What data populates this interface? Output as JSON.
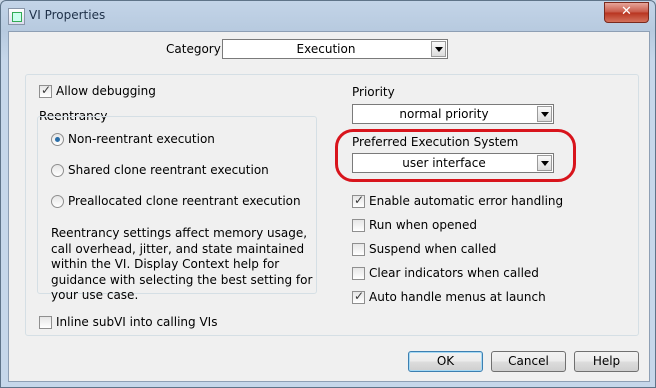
{
  "window": {
    "title": "VI Properties",
    "close_glyph": "✕"
  },
  "category": {
    "label": "Category",
    "value": "Execution"
  },
  "allow_debugging": {
    "label": "Allow debugging",
    "checked": true
  },
  "reentrancy": {
    "title": "Reentrancy",
    "options": [
      {
        "label": "Non-reentrant execution",
        "selected": true
      },
      {
        "label": "Shared clone reentrant execution",
        "selected": false
      },
      {
        "label": "Preallocated clone reentrant execution",
        "selected": false
      }
    ],
    "description": "Reentrancy settings affect memory usage, call overhead, jitter, and state maintained within the VI. Display Context help for guidance with selecting the best setting for your use case."
  },
  "inline_subvi": {
    "label": "Inline subVI into calling VIs",
    "checked": false
  },
  "priority": {
    "label": "Priority",
    "value": "normal priority"
  },
  "execution_system": {
    "label": "Preferred Execution System",
    "value": "user interface"
  },
  "options": [
    {
      "label": "Enable automatic error handling",
      "checked": true
    },
    {
      "label": "Run when opened",
      "checked": false
    },
    {
      "label": "Suspend when called",
      "checked": false
    },
    {
      "label": "Clear indicators when called",
      "checked": false
    },
    {
      "label": "Auto handle menus at launch",
      "checked": true
    }
  ],
  "buttons": {
    "ok": "OK",
    "cancel": "Cancel",
    "help": "Help"
  },
  "colors": {
    "highlight": "#d8141c",
    "dialog_bg": "#f0f0f0",
    "titlebar": "#c3d4e8"
  }
}
